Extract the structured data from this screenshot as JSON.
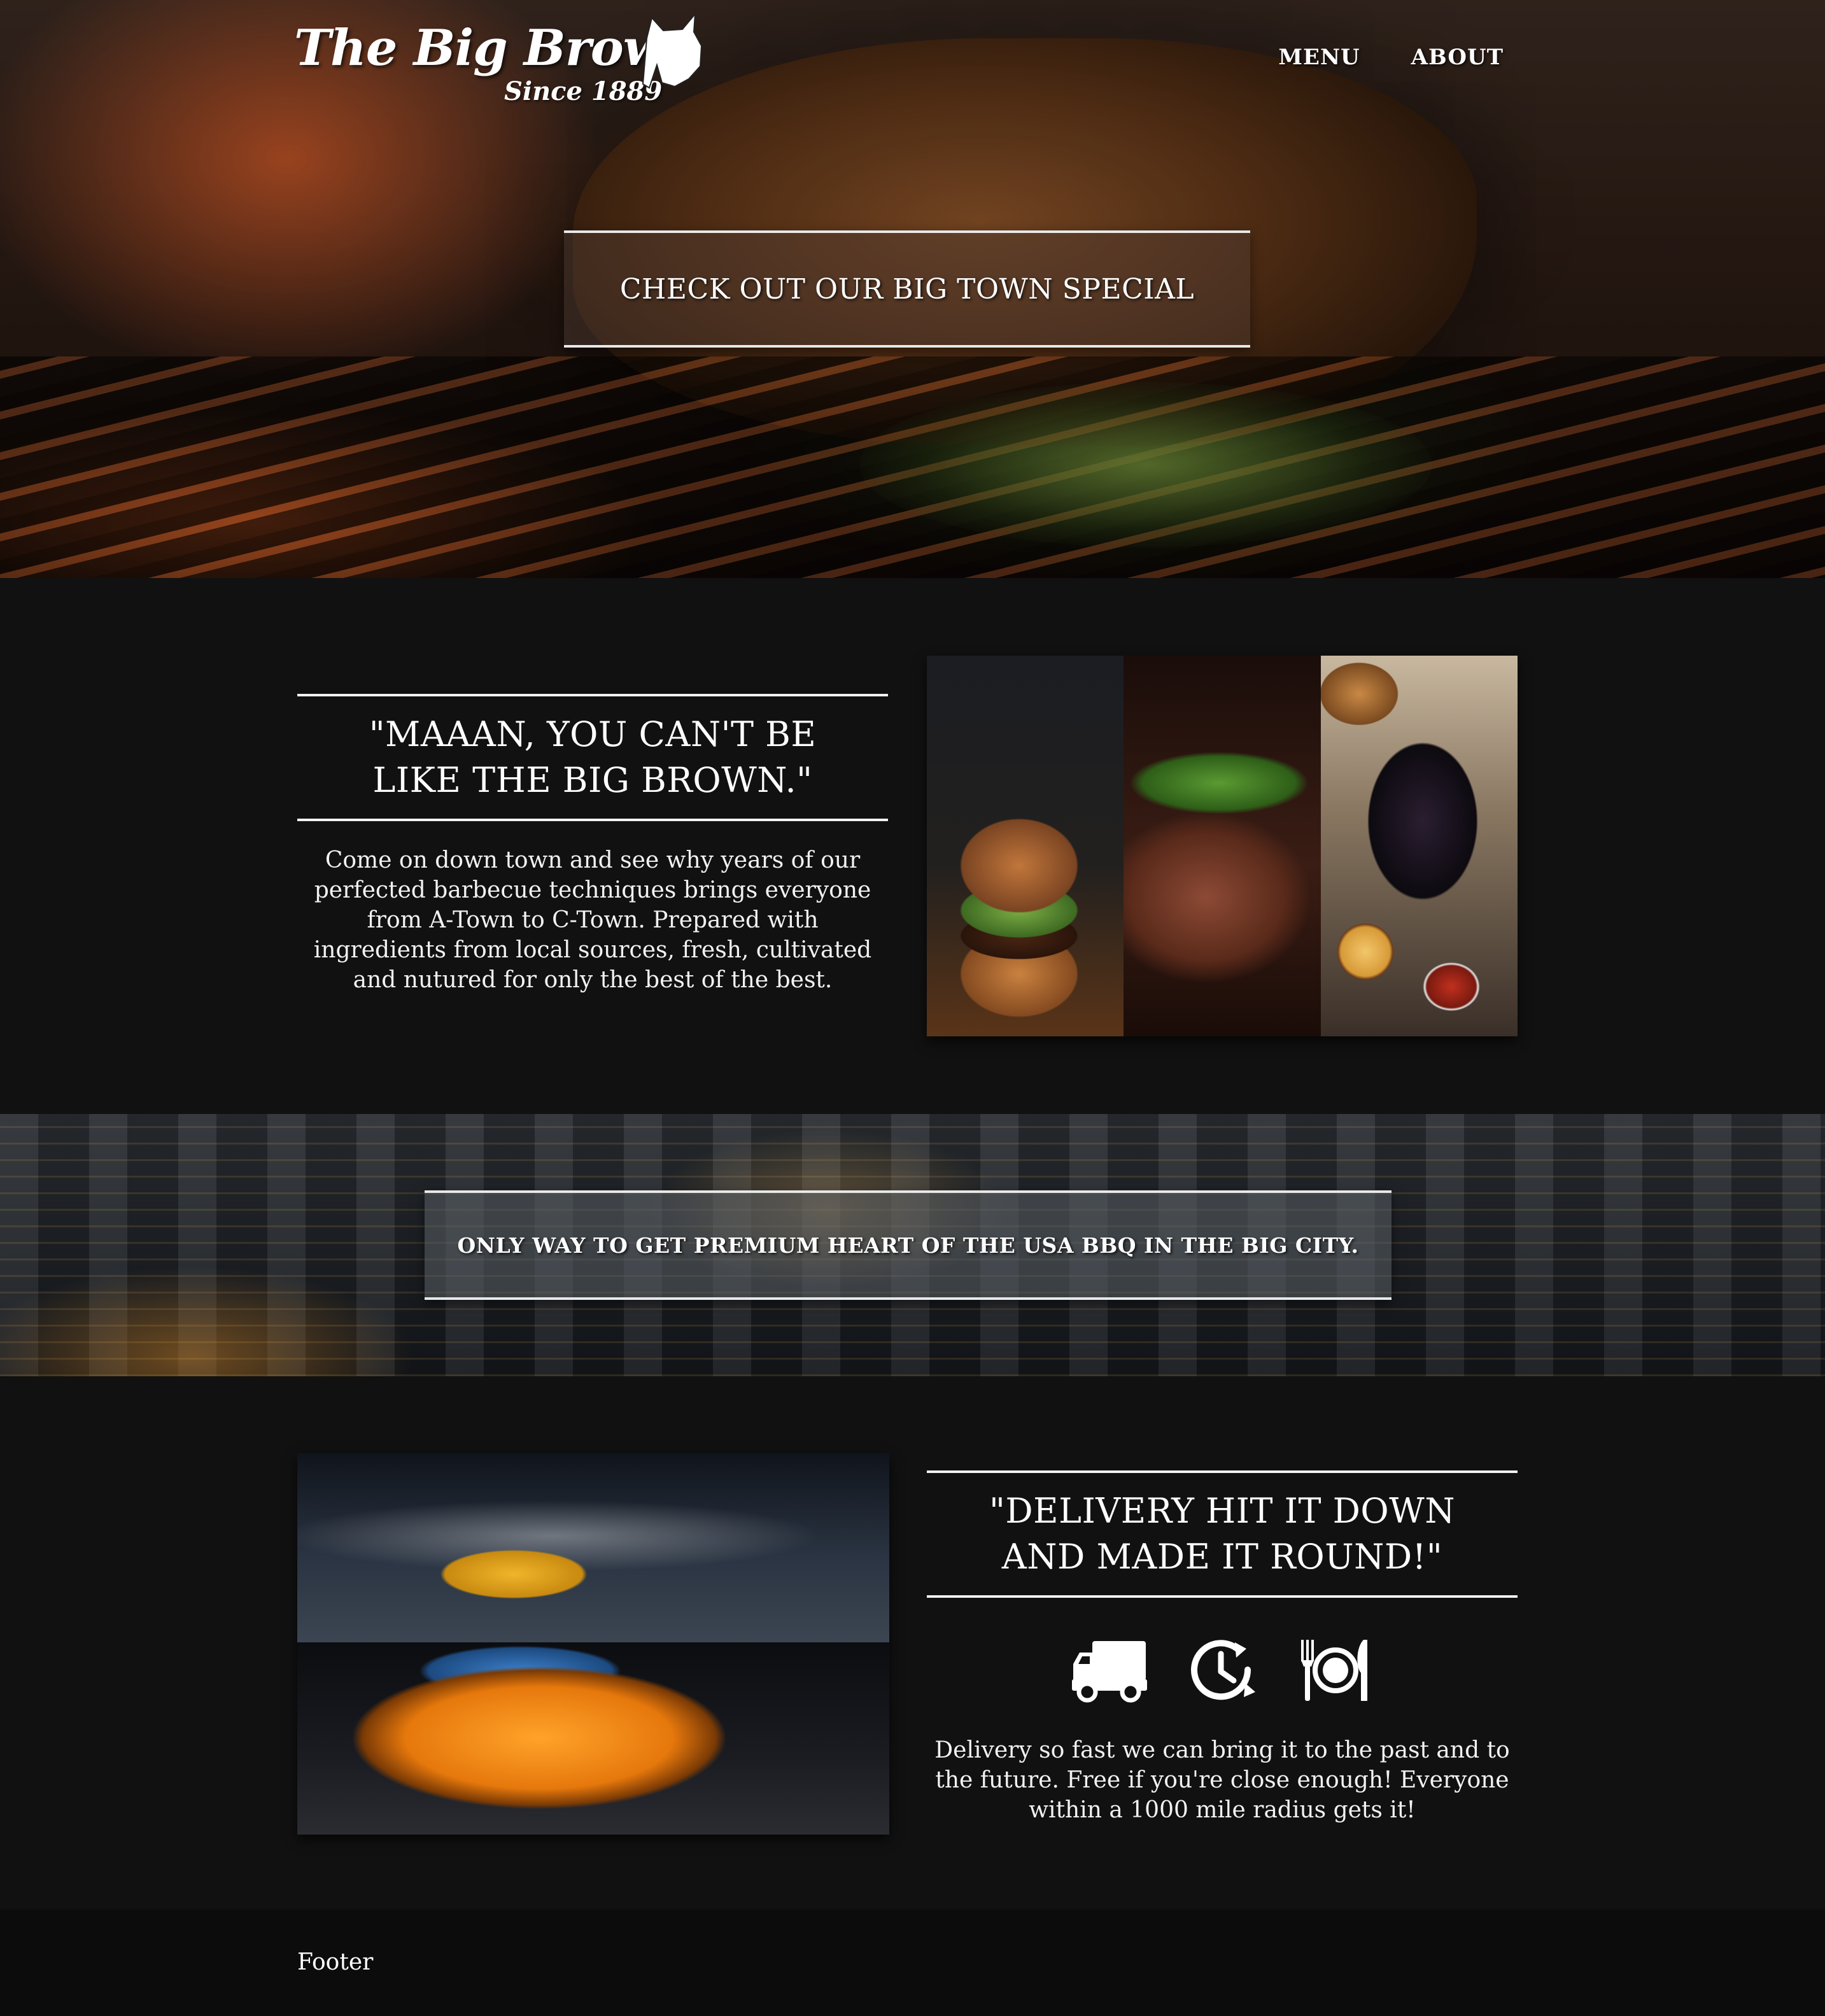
{
  "brand": {
    "name": "The Big Brown",
    "tagline": "Since 1889"
  },
  "nav": {
    "items": [
      "MENU",
      "ABOUT"
    ]
  },
  "hero": {
    "cta_label": "CHECK OUT OUR BIG TOWN SPECIAL"
  },
  "section_one": {
    "quote": "\"MAAAN, YOU CAN'T BE LIKE THE BIG BROWN.\"",
    "body": "Come on down town and see why years of our perfected barbecue techniques brings everyone from A-Town to C-Town. Prepared with ingredients from local sources, fresh, cultivated and nutured for only the best of the best."
  },
  "city_banner": {
    "text": "ONLY WAY TO GET PREMIUM HEART OF THE USA BBQ IN THE BIG CITY."
  },
  "section_two": {
    "quote": "\"DELIVERY HIT IT DOWN AND MADE IT ROUND!\"",
    "icons": [
      "delivery-truck-icon",
      "clock-history-icon",
      "plate-cutlery-icon"
    ],
    "body": "Delivery so fast we can bring it to the past and to the future. Free if you're close enough! Everyone within a 1000 mile radius gets it!"
  },
  "footer": {
    "text": "Footer"
  },
  "colors": {
    "page_background": "#111112",
    "footer_background": "#0c0c0d",
    "text": "#ffffff",
    "rule": "#f2f2f2"
  }
}
